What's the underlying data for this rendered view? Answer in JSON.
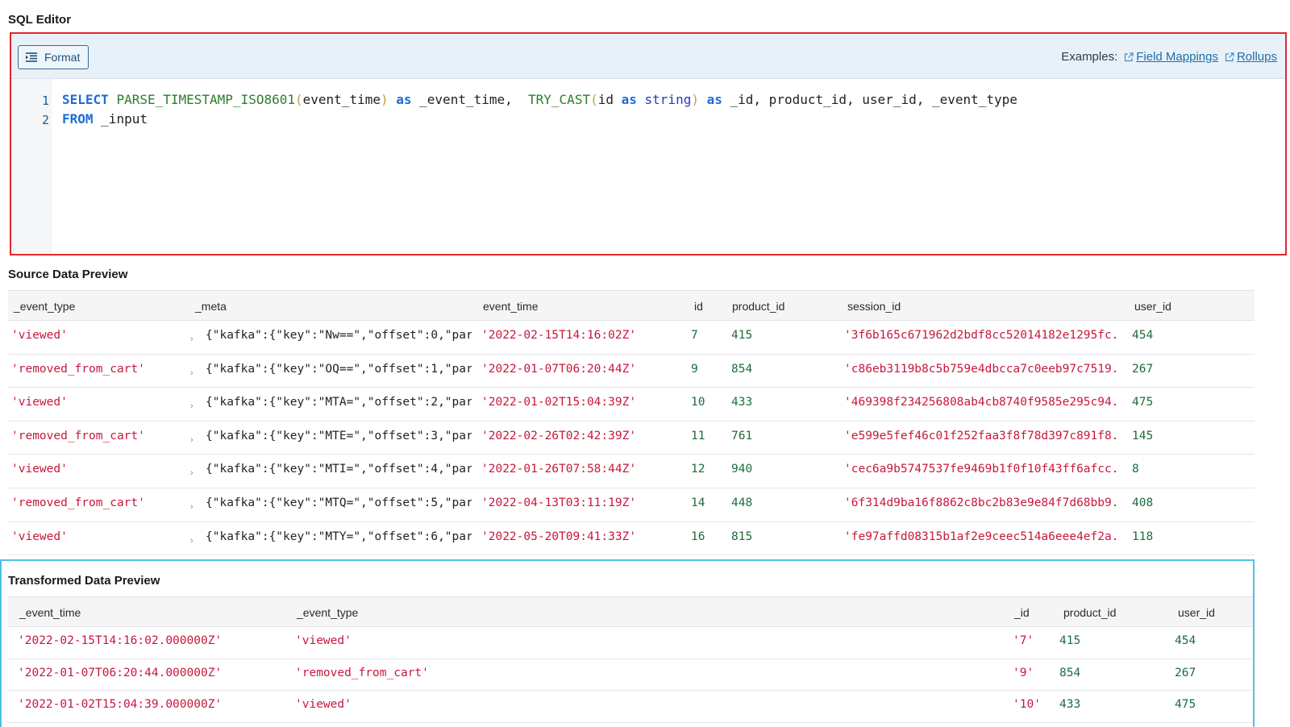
{
  "editor": {
    "title": "SQL Editor",
    "format_label": "Format",
    "examples_label": "Examples:",
    "examples_links": [
      "Field Mappings",
      "Rollups"
    ],
    "line_numbers": [
      "1",
      "2"
    ],
    "line1": {
      "select": "SELECT",
      "fn1": "PARSE_TIMESTAMP_ISO8601",
      "open1": "(",
      "arg1": "event_time",
      "close1": ")",
      "as1": "as",
      "alias1": "_event_time,  ",
      "fn2": "TRY_CAST",
      "open2": "(",
      "arg2": "id ",
      "as2": "as",
      "type2": "string",
      "close2": ")",
      "as3": "as",
      "rest": "_id, product_id, user_id, _event_type"
    },
    "line2": {
      "from": "FROM",
      "rest": "_input"
    }
  },
  "source": {
    "title": "Source Data Preview",
    "columns": [
      "_event_type",
      "_meta",
      "event_time",
      "id",
      "product_id",
      "session_id",
      "user_id"
    ],
    "rows": [
      [
        "'viewed'",
        "{\"kafka\":{\"key\":\"Nw==\",\"offset\":0,\"par...",
        "'2022-02-15T14:16:02Z'",
        "7",
        "415",
        "'3f6b165c671962d2bdf8cc52014182e1295fc...",
        "454"
      ],
      [
        "'removed_from_cart'",
        "{\"kafka\":{\"key\":\"OQ==\",\"offset\":1,\"par...",
        "'2022-01-07T06:20:44Z'",
        "9",
        "854",
        "'c86eb3119b8c5b759e4dbcca7c0eeb97c7519...",
        "267"
      ],
      [
        "'viewed'",
        "{\"kafka\":{\"key\":\"MTA=\",\"offset\":2,\"par...",
        "'2022-01-02T15:04:39Z'",
        "10",
        "433",
        "'469398f234256808ab4cb8740f9585e295c94...",
        "475"
      ],
      [
        "'removed_from_cart'",
        "{\"kafka\":{\"key\":\"MTE=\",\"offset\":3,\"par...",
        "'2022-02-26T02:42:39Z'",
        "11",
        "761",
        "'e599e5fef46c01f252faa3f8f78d397c891f8...",
        "145"
      ],
      [
        "'viewed'",
        "{\"kafka\":{\"key\":\"MTI=\",\"offset\":4,\"par...",
        "'2022-01-26T07:58:44Z'",
        "12",
        "940",
        "'cec6a9b5747537fe9469b1f0f10f43ff6afcc...",
        "8"
      ],
      [
        "'removed_from_cart'",
        "{\"kafka\":{\"key\":\"MTQ=\",\"offset\":5,\"par...",
        "'2022-04-13T03:11:19Z'",
        "14",
        "448",
        "'6f314d9ba16f8862c8bc2b83e9e84f7d68bb9...",
        "408"
      ],
      [
        "'viewed'",
        "{\"kafka\":{\"key\":\"MTY=\",\"offset\":6,\"par...",
        "'2022-05-20T09:41:33Z'",
        "16",
        "815",
        "'fe97affd08315b1af2e9ceec514a6eee4ef2a...",
        "118"
      ]
    ]
  },
  "transformed": {
    "title": "Transformed Data Preview",
    "columns": [
      "_event_time",
      "_event_type",
      "_id",
      "product_id",
      "user_id"
    ],
    "rows": [
      [
        "'2022-02-15T14:16:02.000000Z'",
        "'viewed'",
        "'7'",
        "415",
        "454"
      ],
      [
        "'2022-01-07T06:20:44.000000Z'",
        "'removed_from_cart'",
        "'9'",
        "854",
        "267"
      ],
      [
        "'2022-01-02T15:04:39.000000Z'",
        "'viewed'",
        "'10'",
        "433",
        "475"
      ]
    ]
  }
}
